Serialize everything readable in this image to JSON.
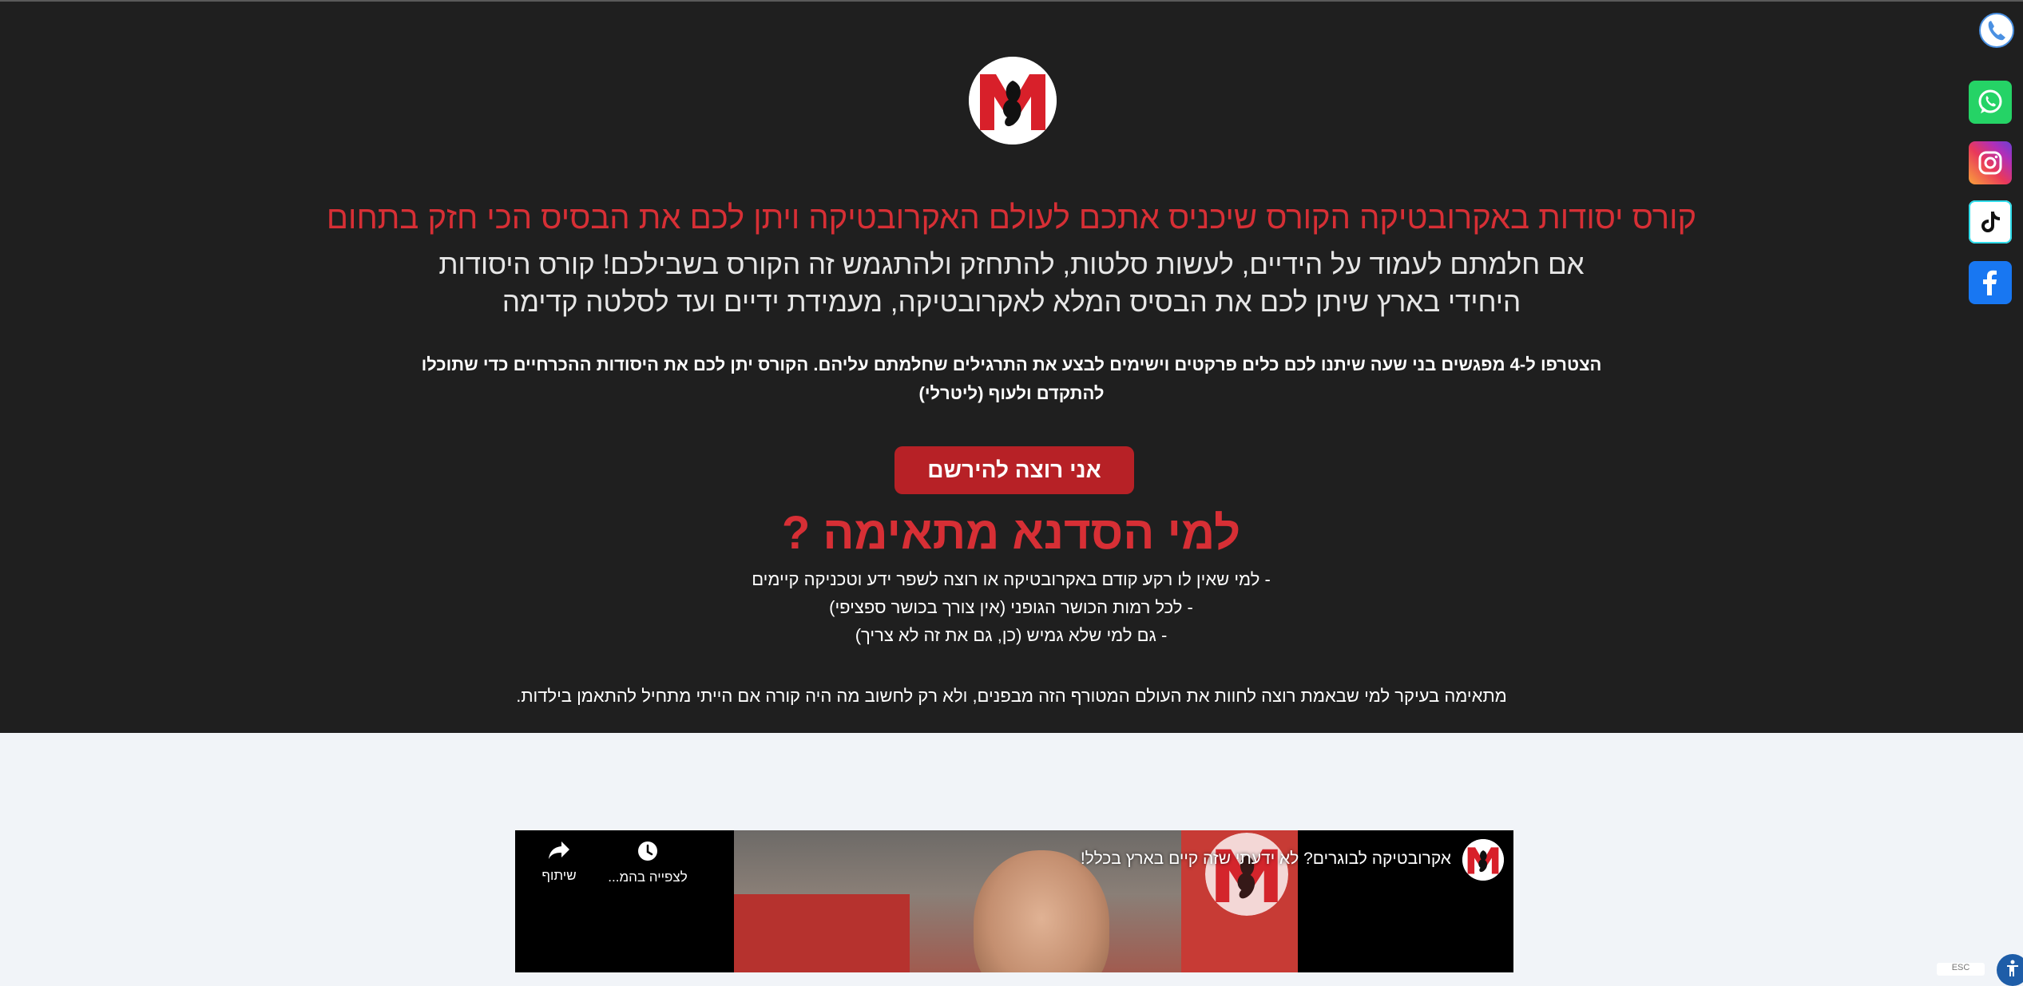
{
  "hero": {
    "headline": "קורס יסודות באקרובטיקה הקורס שיכניס אתכם לעולם האקרובטיקה ויתן לכם את הבסיס הכי חזק בתחום",
    "subhead": "אם חלמתם לעמוד על הידיים, לעשות סלטות, להתחזק ולהתגמש זה הקורס בשבילכם! קורס היסודות היחידי בארץ שיתן לכם את הבסיס המלא לאקרובטיקה, מעמידת ידיים ועד לסלטה קדימה",
    "body": "הצטרפו ל-4 מפגשים בני שעה שיתנו לכם כלים פרקטים וישימים לבצע את התרגילים שחלמתם עליהם. הקורס יתן לכם את היסודות ההכרחיים כדי שתוכלו להתקדם ולעוף (ליטרלי)",
    "cta_label": "אני רוצה להירשם",
    "section_title": "למי הסדנא מתאימה ?",
    "audience": [
      "- למי שאין לו רקע קודם באקרובטיקה או רוצה לשפר ידע וטכניקה קיימים",
      "- לכל רמות הכושר הגופני (אין צורך בכושר ספציפי)",
      "- גם למי שלא גמיש (כן, גם את זה לא צריך)"
    ],
    "summary": "מתאימה בעיקר למי שבאמת רוצה לחוות את העולם המטורף הזה מבפנים, ולא רק לחשוב מה היה קורה אם הייתי מתחיל להתאמן בילדות."
  },
  "social": {
    "phone_icon": "phone-icon",
    "whatsapp_icon": "whatsapp-icon",
    "instagram_icon": "instagram-icon",
    "tiktok_icon": "tiktok-icon",
    "facebook_icon": "facebook-icon"
  },
  "video": {
    "title": "אקרובטיקה לבוגרים? לא ידעתי שזה קיים בארץ בכלל!",
    "share_label": "שיתוף",
    "watch_later_label": "לצפייה בהמ..."
  },
  "accessibility": {
    "esc_label": "ESC"
  },
  "colors": {
    "hero_bg": "#1f1f1f",
    "accent_red": "#d72f35",
    "cta_bg": "#b72126",
    "page_bg": "#f1f4f8"
  }
}
